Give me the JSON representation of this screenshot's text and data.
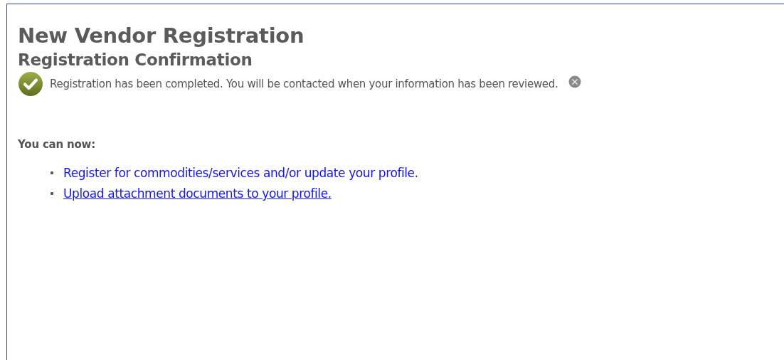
{
  "title": "New Vendor Registration",
  "subtitle": "Registration Confirmation",
  "message": {
    "text": "Registration has been completed. You will be contacted when your information has been reviewed."
  },
  "actions_heading": "You can now:",
  "actions": [
    {
      "label": "Register for commodities/services and/or update your profile.",
      "underlined": false
    },
    {
      "label": "Upload attachment documents to your profile.",
      "underlined": true
    }
  ]
}
